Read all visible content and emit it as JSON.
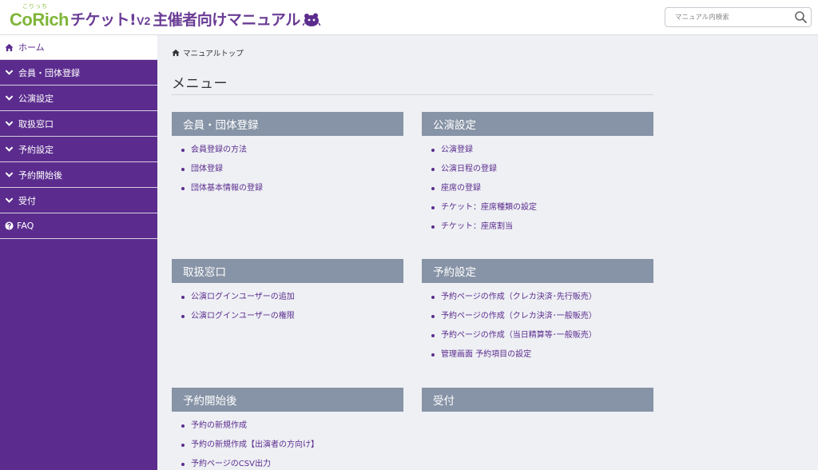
{
  "header": {
    "logo_ruby": "こりっち",
    "logo_brand": "CoRich",
    "logo_title_a": "チケット!",
    "logo_version": "V2",
    "logo_title_b": "主催者向けマニュアル",
    "search_placeholder": "マニュアル内検索"
  },
  "sidebar": {
    "items": [
      {
        "label": "ホーム",
        "icon": "home-icon"
      },
      {
        "label": "会員・団体登録",
        "icon": "chevron-down-icon"
      },
      {
        "label": "公演設定",
        "icon": "chevron-down-icon"
      },
      {
        "label": "取扱窓口",
        "icon": "chevron-down-icon"
      },
      {
        "label": "予約設定",
        "icon": "chevron-down-icon"
      },
      {
        "label": "予約開始後",
        "icon": "chevron-down-icon"
      },
      {
        "label": "受付",
        "icon": "chevron-down-icon"
      },
      {
        "label": "FAQ",
        "icon": "question-circle-icon"
      }
    ]
  },
  "breadcrumb": {
    "label": "マニュアルトップ"
  },
  "page": {
    "title": "メニュー"
  },
  "sections": [
    {
      "title": "会員・団体登録",
      "links": [
        "会員登録の方法",
        "団体登録",
        "団体基本情報の登録"
      ]
    },
    {
      "title": "公演設定",
      "links": [
        "公演登録",
        "公演日程の登録",
        "座席の登録",
        "チケット：座席種類の設定",
        "チケット：座席割当"
      ]
    },
    {
      "title": "取扱窓口",
      "links": [
        "公演ログインユーザーの追加",
        "公演ログインユーザーの権限"
      ]
    },
    {
      "title": "予約設定",
      "links": [
        "予約ページの作成（クレカ決済･先行販売）",
        "予約ページの作成（クレカ決済･一般販売）",
        "予約ページの作成（当日精算等･一般販売）",
        "管理画面 予約項目の設定"
      ]
    },
    {
      "title": "予約開始後",
      "links": [
        "予約の新規作成",
        "予約の新規作成【出演者の方向け】",
        "予約ページのCSV出力"
      ]
    },
    {
      "title": "受付",
      "links": []
    }
  ],
  "colors": {
    "sidebar_bg": "#5b2c8e",
    "section_header_bg": "#8793a6",
    "link": "#5b2c8e",
    "brand_green": "#7fb63a"
  }
}
